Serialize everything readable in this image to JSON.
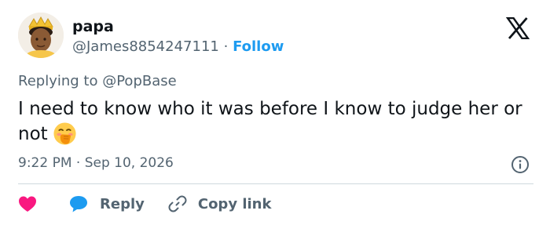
{
  "author": {
    "name": "papa",
    "handle": "@James8854247111",
    "separator": "·",
    "follow_label": "Follow"
  },
  "brand": {
    "logo_icon": "x-logo-icon",
    "color": "#0f1419"
  },
  "reply_context": {
    "prefix": "Replying to",
    "mention": "@PopBase"
  },
  "tweet": {
    "text": "I need to know who it was before I know to judge her or not",
    "emoji_icon": "face-with-hand-over-mouth-icon"
  },
  "meta": {
    "time": "9:22 PM",
    "separator": "·",
    "date": "Sep 10, 2026",
    "info_icon": "info-icon"
  },
  "actions": {
    "like_icon": "heart-icon",
    "reply_label": "Reply",
    "reply_icon": "speech-bubble-icon",
    "copy_label": "Copy link",
    "copy_icon": "link-icon"
  },
  "colors": {
    "accent": "#1d9bf0",
    "like": "#f91880",
    "secondary_text": "#536471",
    "divider": "#cfd9de"
  }
}
